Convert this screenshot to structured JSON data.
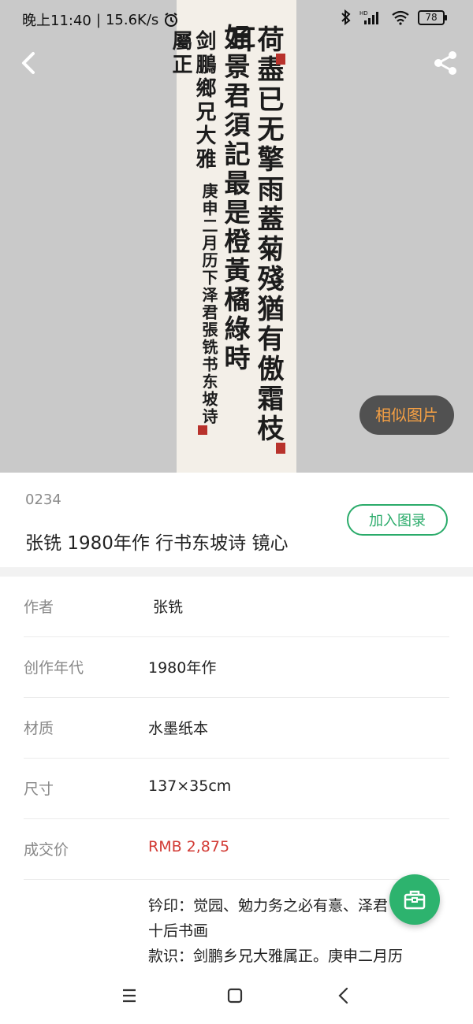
{
  "status_bar": {
    "time": "晚上11:40",
    "separator": "|",
    "speed": "15.6K/s",
    "battery": "78",
    "icons": [
      "alarm-icon",
      "bluetooth-icon",
      "hd-signal-icon",
      "wifi-icon",
      "battery-icon"
    ]
  },
  "header": {
    "back_icon": "chevron-left-icon",
    "share_icon": "share-icon"
  },
  "artwork": {
    "column_1": "荷盡已无擎雨蓋菊殘猶有傲霜枝耳",
    "column_2": "好景君須記最是橙黃橘綠時",
    "column_3": "剑鵬鄉兄大雅屬正",
    "column_4": "庚申二月历下泽君張铣书东坡诗"
  },
  "similar_button": "相似图片",
  "lot": {
    "number": "0234",
    "title": "张铣 1980年作 行书东坡诗 镜心",
    "add_button": "加入图录"
  },
  "details": [
    {
      "label": "作者",
      "value": "张铣"
    },
    {
      "label": "创作年代",
      "value": "1980年作"
    },
    {
      "label": "材质",
      "value": "水墨纸本"
    },
    {
      "label": "尺寸",
      "value": "137×35cm"
    },
    {
      "label": "成交价",
      "value": "RMB 2,875"
    }
  ],
  "extra_lines": [
    "钤印：觉园、勉力务之必有憙、泽君",
    "十后书画",
    "款识：剑鹏乡兄大雅属正。庚申二月历"
  ],
  "fab_icon": "briefcase-icon",
  "nav_bar": {
    "menu_icon": "menu-icon",
    "home_icon": "home-square-icon",
    "back_icon": "back-triangle-icon"
  },
  "colors": {
    "accent_green": "#2aab6a",
    "price_red": "#d23a34",
    "similar_text": "#f5a044"
  }
}
